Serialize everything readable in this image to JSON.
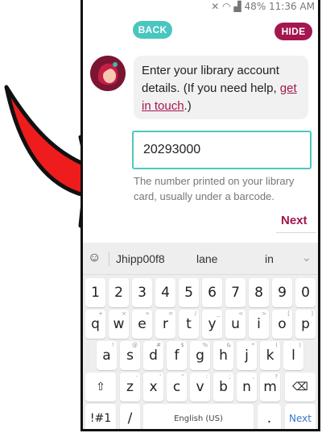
{
  "status_bar": {
    "text": "48% 11:36 AM"
  },
  "header": {
    "back_label": "BACK",
    "hide_label": "HIDE"
  },
  "message": {
    "text_before": "Enter your library account details. (If you need help, ",
    "link_text": "get in touch",
    "text_after": ".)"
  },
  "form": {
    "card_number_value": "20293000",
    "helper_text": "The number printed on your library card, usually under a barcode.",
    "next_label": "Next"
  },
  "keyboard": {
    "suggestions": [
      "Jhipp00f8",
      "lane",
      "in"
    ],
    "row_numbers": [
      "1",
      "2",
      "3",
      "4",
      "5",
      "6",
      "7",
      "8",
      "9",
      "0"
    ],
    "row1": [
      "q",
      "w",
      "e",
      "r",
      "t",
      "y",
      "u",
      "i",
      "o",
      "p"
    ],
    "row1_alt": [
      "+",
      "×",
      "÷",
      "=",
      "/",
      "_",
      "<",
      ">",
      "[",
      "]"
    ],
    "row2": [
      "a",
      "s",
      "d",
      "f",
      "g",
      "h",
      "j",
      "k",
      "l"
    ],
    "row2_alt": [
      "!",
      "@",
      "#",
      "$",
      "%",
      "&",
      "*",
      "(",
      ")"
    ],
    "row3": [
      "z",
      "x",
      "c",
      "v",
      "b",
      "n",
      "m"
    ],
    "row3_alt": [
      "-",
      "'",
      "\"",
      ":",
      ";",
      ",",
      "?"
    ],
    "symbols_label": "!#1",
    "slash_label": "/",
    "space_label": "English (US)",
    "period_label": ".",
    "action_label": "Next"
  },
  "colors": {
    "accent_teal": "#49c6c0",
    "accent_maroon": "#a4164f",
    "arrow_red": "#ee1c1c"
  }
}
